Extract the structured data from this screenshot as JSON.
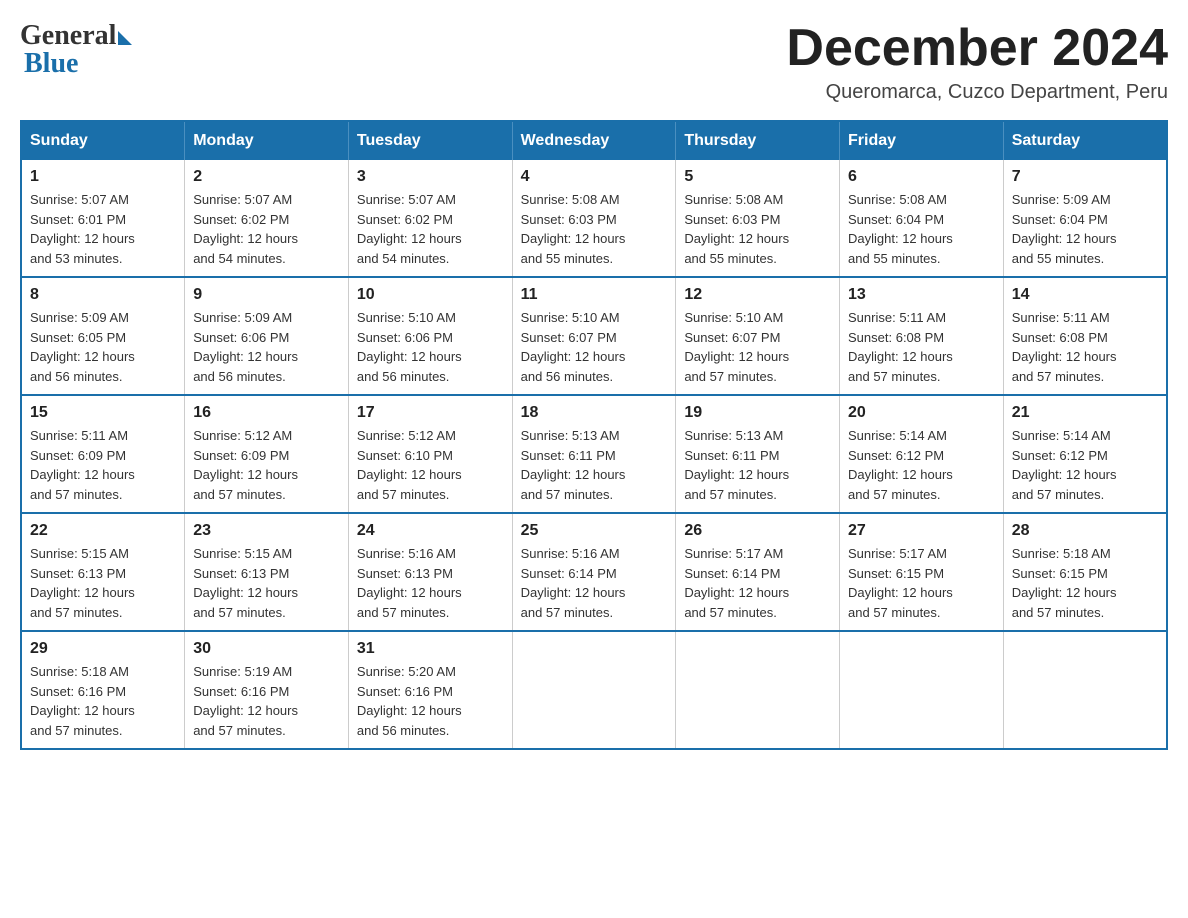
{
  "logo": {
    "general": "General",
    "blue": "Blue"
  },
  "title": "December 2024",
  "location": "Queromarca, Cuzco Department, Peru",
  "days_of_week": [
    "Sunday",
    "Monday",
    "Tuesday",
    "Wednesday",
    "Thursday",
    "Friday",
    "Saturday"
  ],
  "weeks": [
    [
      {
        "day": "1",
        "sunrise": "5:07 AM",
        "sunset": "6:01 PM",
        "daylight": "12 hours and 53 minutes."
      },
      {
        "day": "2",
        "sunrise": "5:07 AM",
        "sunset": "6:02 PM",
        "daylight": "12 hours and 54 minutes."
      },
      {
        "day": "3",
        "sunrise": "5:07 AM",
        "sunset": "6:02 PM",
        "daylight": "12 hours and 54 minutes."
      },
      {
        "day": "4",
        "sunrise": "5:08 AM",
        "sunset": "6:03 PM",
        "daylight": "12 hours and 55 minutes."
      },
      {
        "day": "5",
        "sunrise": "5:08 AM",
        "sunset": "6:03 PM",
        "daylight": "12 hours and 55 minutes."
      },
      {
        "day": "6",
        "sunrise": "5:08 AM",
        "sunset": "6:04 PM",
        "daylight": "12 hours and 55 minutes."
      },
      {
        "day": "7",
        "sunrise": "5:09 AM",
        "sunset": "6:04 PM",
        "daylight": "12 hours and 55 minutes."
      }
    ],
    [
      {
        "day": "8",
        "sunrise": "5:09 AM",
        "sunset": "6:05 PM",
        "daylight": "12 hours and 56 minutes."
      },
      {
        "day": "9",
        "sunrise": "5:09 AM",
        "sunset": "6:06 PM",
        "daylight": "12 hours and 56 minutes."
      },
      {
        "day": "10",
        "sunrise": "5:10 AM",
        "sunset": "6:06 PM",
        "daylight": "12 hours and 56 minutes."
      },
      {
        "day": "11",
        "sunrise": "5:10 AM",
        "sunset": "6:07 PM",
        "daylight": "12 hours and 56 minutes."
      },
      {
        "day": "12",
        "sunrise": "5:10 AM",
        "sunset": "6:07 PM",
        "daylight": "12 hours and 57 minutes."
      },
      {
        "day": "13",
        "sunrise": "5:11 AM",
        "sunset": "6:08 PM",
        "daylight": "12 hours and 57 minutes."
      },
      {
        "day": "14",
        "sunrise": "5:11 AM",
        "sunset": "6:08 PM",
        "daylight": "12 hours and 57 minutes."
      }
    ],
    [
      {
        "day": "15",
        "sunrise": "5:11 AM",
        "sunset": "6:09 PM",
        "daylight": "12 hours and 57 minutes."
      },
      {
        "day": "16",
        "sunrise": "5:12 AM",
        "sunset": "6:09 PM",
        "daylight": "12 hours and 57 minutes."
      },
      {
        "day": "17",
        "sunrise": "5:12 AM",
        "sunset": "6:10 PM",
        "daylight": "12 hours and 57 minutes."
      },
      {
        "day": "18",
        "sunrise": "5:13 AM",
        "sunset": "6:11 PM",
        "daylight": "12 hours and 57 minutes."
      },
      {
        "day": "19",
        "sunrise": "5:13 AM",
        "sunset": "6:11 PM",
        "daylight": "12 hours and 57 minutes."
      },
      {
        "day": "20",
        "sunrise": "5:14 AM",
        "sunset": "6:12 PM",
        "daylight": "12 hours and 57 minutes."
      },
      {
        "day": "21",
        "sunrise": "5:14 AM",
        "sunset": "6:12 PM",
        "daylight": "12 hours and 57 minutes."
      }
    ],
    [
      {
        "day": "22",
        "sunrise": "5:15 AM",
        "sunset": "6:13 PM",
        "daylight": "12 hours and 57 minutes."
      },
      {
        "day": "23",
        "sunrise": "5:15 AM",
        "sunset": "6:13 PM",
        "daylight": "12 hours and 57 minutes."
      },
      {
        "day": "24",
        "sunrise": "5:16 AM",
        "sunset": "6:13 PM",
        "daylight": "12 hours and 57 minutes."
      },
      {
        "day": "25",
        "sunrise": "5:16 AM",
        "sunset": "6:14 PM",
        "daylight": "12 hours and 57 minutes."
      },
      {
        "day": "26",
        "sunrise": "5:17 AM",
        "sunset": "6:14 PM",
        "daylight": "12 hours and 57 minutes."
      },
      {
        "day": "27",
        "sunrise": "5:17 AM",
        "sunset": "6:15 PM",
        "daylight": "12 hours and 57 minutes."
      },
      {
        "day": "28",
        "sunrise": "5:18 AM",
        "sunset": "6:15 PM",
        "daylight": "12 hours and 57 minutes."
      }
    ],
    [
      {
        "day": "29",
        "sunrise": "5:18 AM",
        "sunset": "6:16 PM",
        "daylight": "12 hours and 57 minutes."
      },
      {
        "day": "30",
        "sunrise": "5:19 AM",
        "sunset": "6:16 PM",
        "daylight": "12 hours and 57 minutes."
      },
      {
        "day": "31",
        "sunrise": "5:20 AM",
        "sunset": "6:16 PM",
        "daylight": "12 hours and 56 minutes."
      },
      null,
      null,
      null,
      null
    ]
  ],
  "labels": {
    "sunrise": "Sunrise:",
    "sunset": "Sunset:",
    "daylight": "Daylight:"
  }
}
